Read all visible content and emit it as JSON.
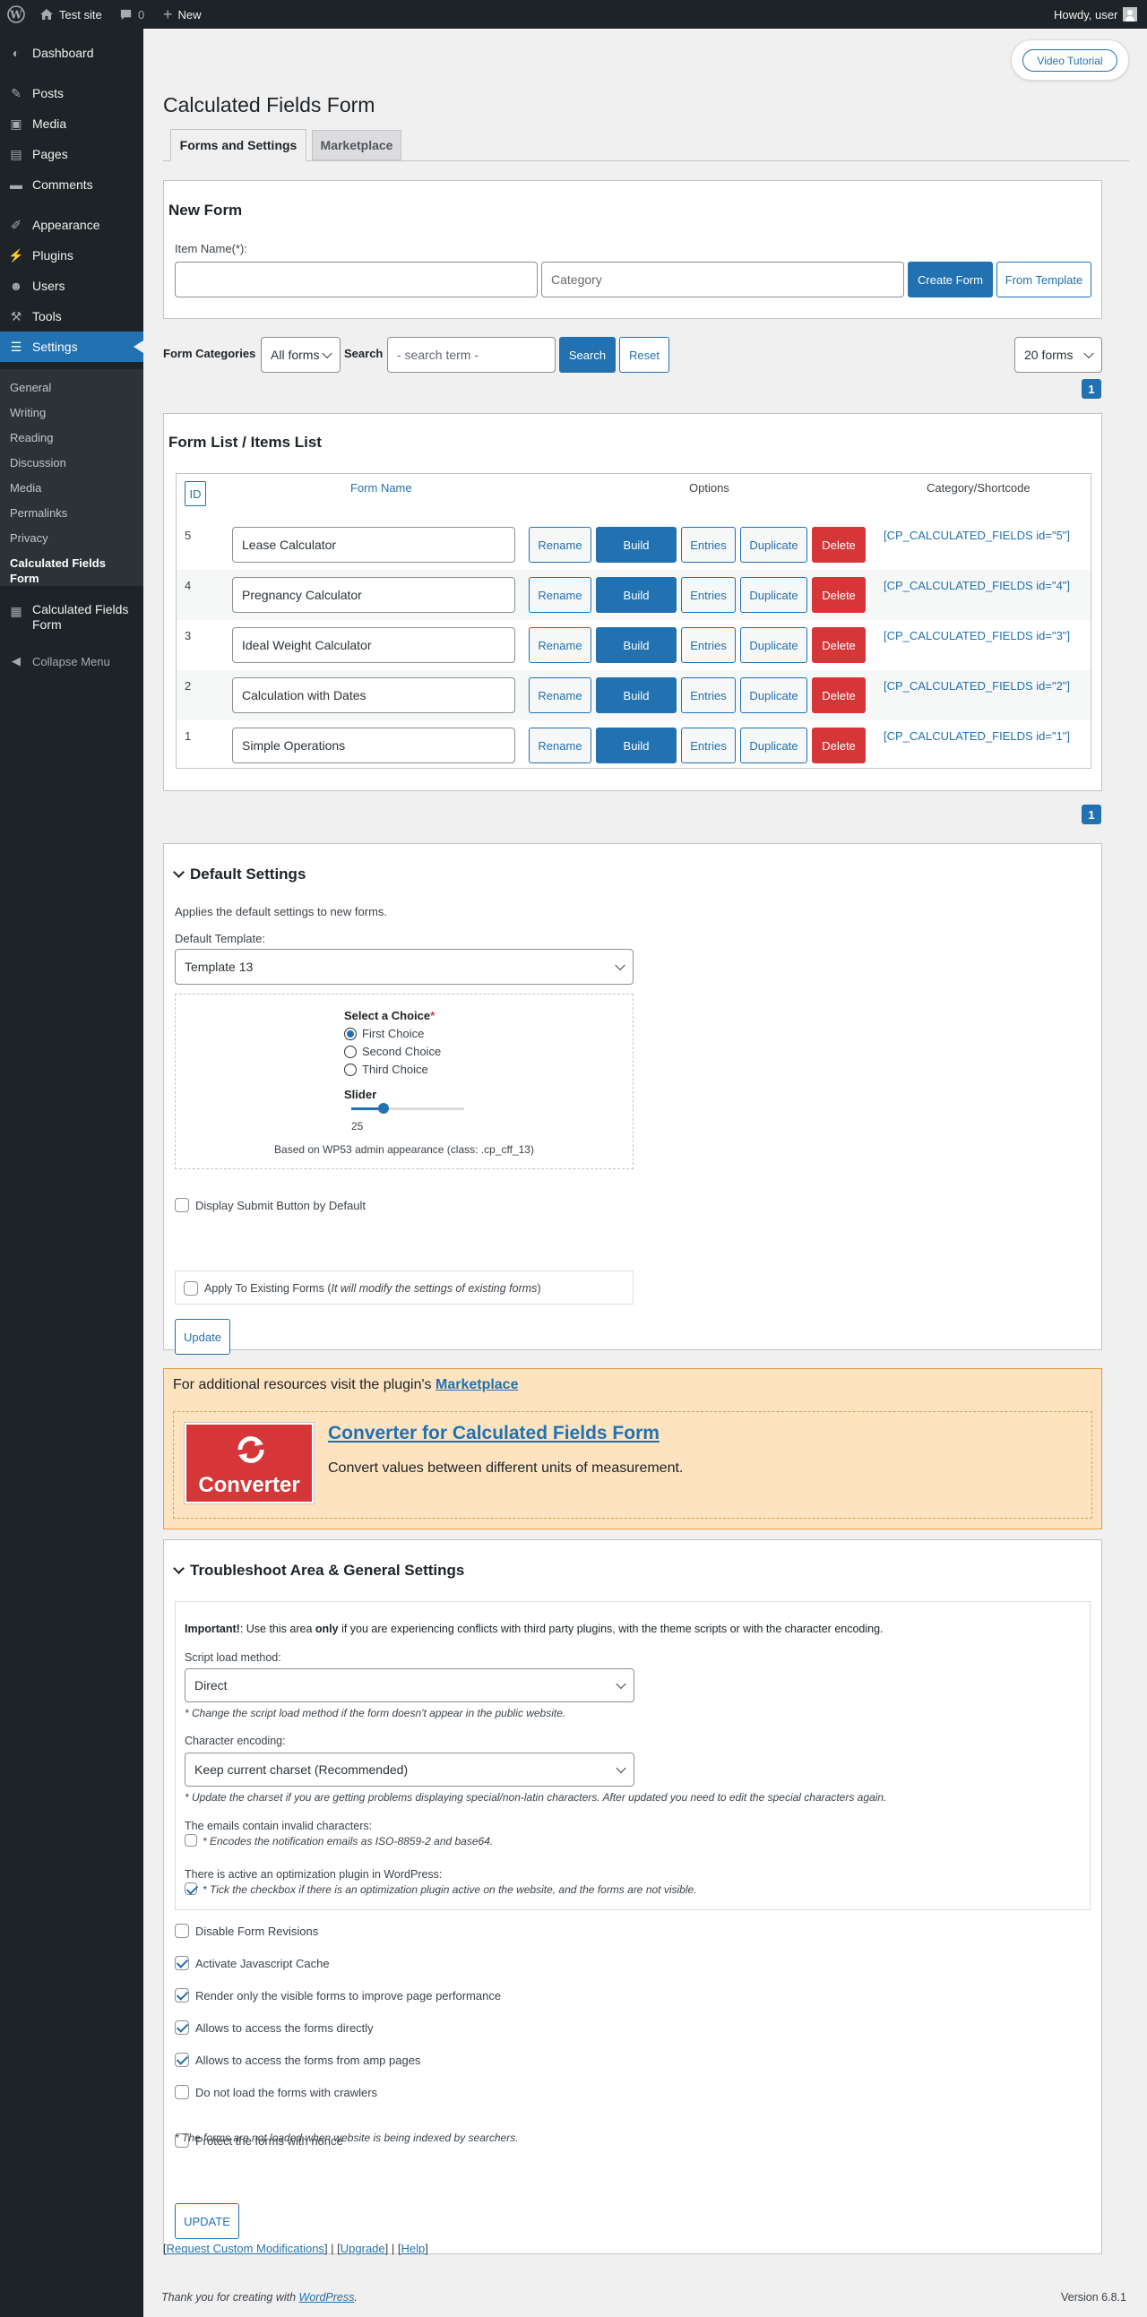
{
  "topbar": {
    "site_name": "Test site",
    "comments_count": "0",
    "new_label": "New",
    "howdy": "Howdy, user"
  },
  "sidebar": {
    "items": [
      {
        "label": "Dashboard",
        "icon": "dashboard-icon"
      },
      {
        "label": "Posts",
        "icon": "pin-icon"
      },
      {
        "label": "Media",
        "icon": "media-icon"
      },
      {
        "label": "Pages",
        "icon": "pages-icon"
      },
      {
        "label": "Comments",
        "icon": "comments-icon"
      },
      {
        "label": "Appearance",
        "icon": "brush-icon"
      },
      {
        "label": "Plugins",
        "icon": "plug-icon"
      },
      {
        "label": "Users",
        "icon": "users-icon"
      },
      {
        "label": "Tools",
        "icon": "wrench-icon"
      },
      {
        "label": "Settings",
        "icon": "settings-icon"
      }
    ],
    "submenu": [
      "General",
      "Writing",
      "Reading",
      "Discussion",
      "Media",
      "Permalinks",
      "Privacy",
      "Calculated Fields Form"
    ],
    "plugin_item": "Calculated Fields Form",
    "collapse": "Collapse Menu"
  },
  "header": {
    "video_tutorial": "Video Tutorial",
    "title": "Calculated Fields Form",
    "tabs": [
      "Forms and Settings",
      "Marketplace"
    ]
  },
  "new_form": {
    "title": "New Form",
    "item_name_label": "Item Name(*):",
    "item_name_value": "",
    "category_placeholder": "Category",
    "create_button": "Create Form",
    "template_button": "From Template"
  },
  "filter": {
    "categories_label": "Form Categories",
    "categories_value": "All forms",
    "search_label": "Search",
    "search_placeholder": "- search term -",
    "search_button": "Search",
    "reset_button": "Reset",
    "per_page": "20 forms",
    "page": "1"
  },
  "form_list": {
    "title": "Form List / Items List",
    "headers": {
      "id": "ID",
      "name": "Form Name",
      "options": "Options",
      "shortcode": "Category/Shortcode"
    },
    "actions": {
      "rename": "Rename",
      "build": "Build",
      "entries": "Entries",
      "duplicate": "Duplicate",
      "delete": "Delete"
    },
    "rows": [
      {
        "id": "5",
        "name": "Lease Calculator",
        "shortcode": "[CP_CALCULATED_FIELDS id=\"5\"]"
      },
      {
        "id": "4",
        "name": "Pregnancy Calculator",
        "shortcode": "[CP_CALCULATED_FIELDS id=\"4\"]"
      },
      {
        "id": "3",
        "name": "Ideal Weight Calculator",
        "shortcode": "[CP_CALCULATED_FIELDS id=\"3\"]"
      },
      {
        "id": "2",
        "name": "Calculation with Dates",
        "shortcode": "[CP_CALCULATED_FIELDS id=\"2\"]"
      },
      {
        "id": "1",
        "name": "Simple Operations",
        "shortcode": "[CP_CALCULATED_FIELDS id=\"1\"]"
      }
    ],
    "page_bottom": "1"
  },
  "default_settings": {
    "title": "Default Settings",
    "description": "Applies the default settings to new forms.",
    "template_label": "Default Template:",
    "template_value": "Template 13",
    "preview": {
      "choice_label": "Select a Choice",
      "required": "*",
      "choices": [
        "First Choice",
        "Second Choice",
        "Third Choice"
      ],
      "slider_label": "Slider",
      "slider_value": "25",
      "caption": "Based on WP53 admin appearance (class: .cp_cff_13)"
    },
    "display_submit": "Display Submit Button by Default",
    "apply_existing": "Apply To Existing Forms (",
    "apply_existing_note": "It will modify the settings of existing forms",
    "apply_existing_close": ")",
    "update_button": "Update"
  },
  "marketplace_banner": {
    "text": "For additional resources visit the plugin's",
    "link": "Marketplace",
    "logo_text": "Converter",
    "product_title": "Converter for Calculated Fields Form",
    "product_desc": "Convert values between different units of measurement."
  },
  "troubleshoot": {
    "title": "Troubleshoot Area & General Settings",
    "important_bold": "Important!",
    "important_text1": ": Use this area ",
    "important_only": "only",
    "important_text2": " if you are experiencing conflicts with third party plugins, with the theme scripts or with the character encoding.",
    "script_label": "Script load method:",
    "script_value": "Direct",
    "script_note": "* Change the script load method if the form doesn't appear in the public website.",
    "charset_label": "Character encoding:",
    "charset_value": "Keep current charset (Recommended)",
    "charset_note": "* Update the charset if you are getting problems displaying special/non-latin characters. After updated you need to edit the special characters again.",
    "emails_label": "The emails contain invalid characters:",
    "emails_note": "* Encodes the notification emails as ISO-8859-2 and base64.",
    "optim_label": "There is active an optimization plugin in WordPress:",
    "optim_note": "* Tick the checkbox if there is an optimization plugin active on the website, and the forms are not visible.",
    "options": [
      {
        "label": "Disable Form Revisions",
        "checked": false
      },
      {
        "label": "Activate Javascript Cache",
        "checked": true
      },
      {
        "label": "Render only the visible forms to improve page performance",
        "checked": true
      },
      {
        "label": "Allows to access the forms directly",
        "checked": true
      },
      {
        "label": "Allows to access the forms from amp pages",
        "checked": true
      },
      {
        "label": "Do not load the forms with crawlers",
        "checked": false
      },
      {
        "label": "Protect the forms with nonce",
        "checked": false
      }
    ],
    "crawlers_note": "* The forms are not loaded when website is being indexed by searchers.",
    "update_button": "UPDATE"
  },
  "links": {
    "request": "Request Custom Modifications",
    "upgrade": "Upgrade",
    "help": "Help"
  },
  "footer": {
    "thanks": "Thank you for creating with ",
    "wp": "WordPress",
    "period": ".",
    "version": "Version 6.8.1"
  },
  "colors": {
    "accent": "#2271b1",
    "danger": "#d63638",
    "sidebar": "#1d2327",
    "banner_bg": "#fde3c0",
    "banner_border": "#e89a3c"
  }
}
